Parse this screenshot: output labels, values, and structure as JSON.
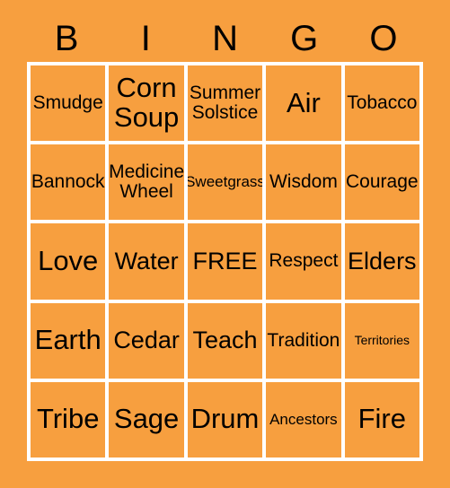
{
  "card": {
    "background_color": "#f79f3f",
    "gridline_color": "#ffffff",
    "text_color": "#000000",
    "header_letters": [
      "B",
      "I",
      "N",
      "G",
      "O"
    ],
    "rows": [
      [
        {
          "label": "Smudge",
          "size": "fs-md"
        },
        {
          "label": "Corn Soup",
          "size": "fs-xl"
        },
        {
          "label": "Summer Solstice",
          "size": "fs-md"
        },
        {
          "label": "Air",
          "size": "fs-xl"
        },
        {
          "label": "Tobacco",
          "size": "fs-md"
        }
      ],
      [
        {
          "label": "Bannock",
          "size": "fs-md"
        },
        {
          "label": "Medicine Wheel",
          "size": "fs-md"
        },
        {
          "label": "Sweetgrass",
          "size": "fs-sm"
        },
        {
          "label": "Wisdom",
          "size": "fs-md"
        },
        {
          "label": "Courage",
          "size": "fs-md"
        }
      ],
      [
        {
          "label": "Love",
          "size": "fs-xl"
        },
        {
          "label": "Water",
          "size": "fs-lg"
        },
        {
          "label": "FREE",
          "size": "fs-lg"
        },
        {
          "label": "Respect",
          "size": "fs-md"
        },
        {
          "label": "Elders",
          "size": "fs-lg"
        }
      ],
      [
        {
          "label": "Earth",
          "size": "fs-xl"
        },
        {
          "label": "Cedar",
          "size": "fs-lg"
        },
        {
          "label": "Teach",
          "size": "fs-lg"
        },
        {
          "label": "Tradition",
          "size": "fs-md"
        },
        {
          "label": "Territories",
          "size": "fs-xs"
        }
      ],
      [
        {
          "label": "Tribe",
          "size": "fs-xl"
        },
        {
          "label": "Sage",
          "size": "fs-xl"
        },
        {
          "label": "Drum",
          "size": "fs-xl"
        },
        {
          "label": "Ancestors",
          "size": "fs-sm"
        },
        {
          "label": "Fire",
          "size": "fs-xl"
        }
      ]
    ]
  }
}
